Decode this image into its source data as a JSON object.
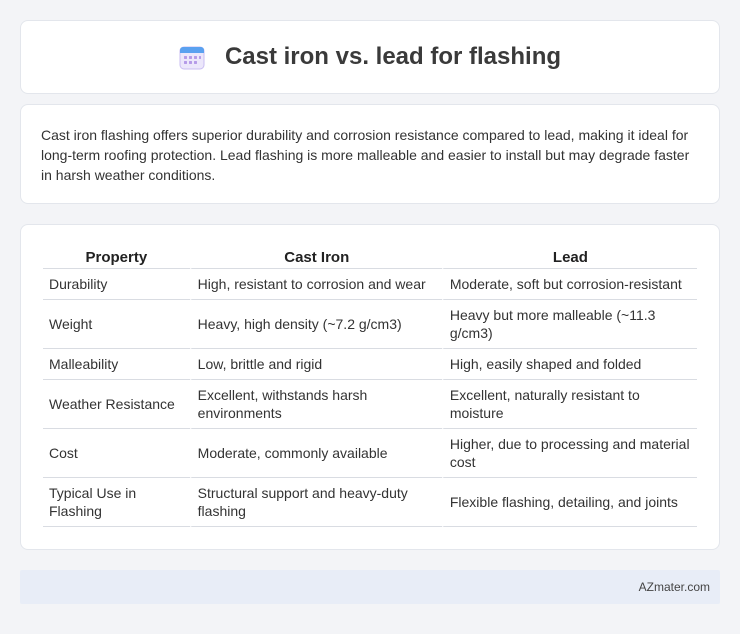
{
  "header": {
    "title": "Cast iron vs. lead for flashing",
    "icon": "calendar-icon"
  },
  "intro": "Cast iron flashing offers superior durability and corrosion resistance compared to lead, making it ideal for long-term roofing protection. Lead flashing is more malleable and easier to install but may degrade faster in harsh weather conditions.",
  "table": {
    "headers": [
      "Property",
      "Cast Iron",
      "Lead"
    ],
    "rows": [
      [
        "Durability",
        "High, resistant to corrosion and wear",
        "Moderate, soft but corrosion-resistant"
      ],
      [
        "Weight",
        "Heavy, high density (~7.2 g/cm3)",
        "Heavy but more malleable (~11.3 g/cm3)"
      ],
      [
        "Malleability",
        "Low, brittle and rigid",
        "High, easily shaped and folded"
      ],
      [
        "Weather Resistance",
        "Excellent, withstands harsh environments",
        "Excellent, naturally resistant to moisture"
      ],
      [
        "Cost",
        "Moderate, commonly available",
        "Higher, due to processing and material cost"
      ],
      [
        "Typical Use in Flashing",
        "Structural support and heavy-duty flashing",
        "Flexible flashing, detailing, and joints"
      ]
    ]
  },
  "footer": {
    "brand": "AZmater.com"
  }
}
